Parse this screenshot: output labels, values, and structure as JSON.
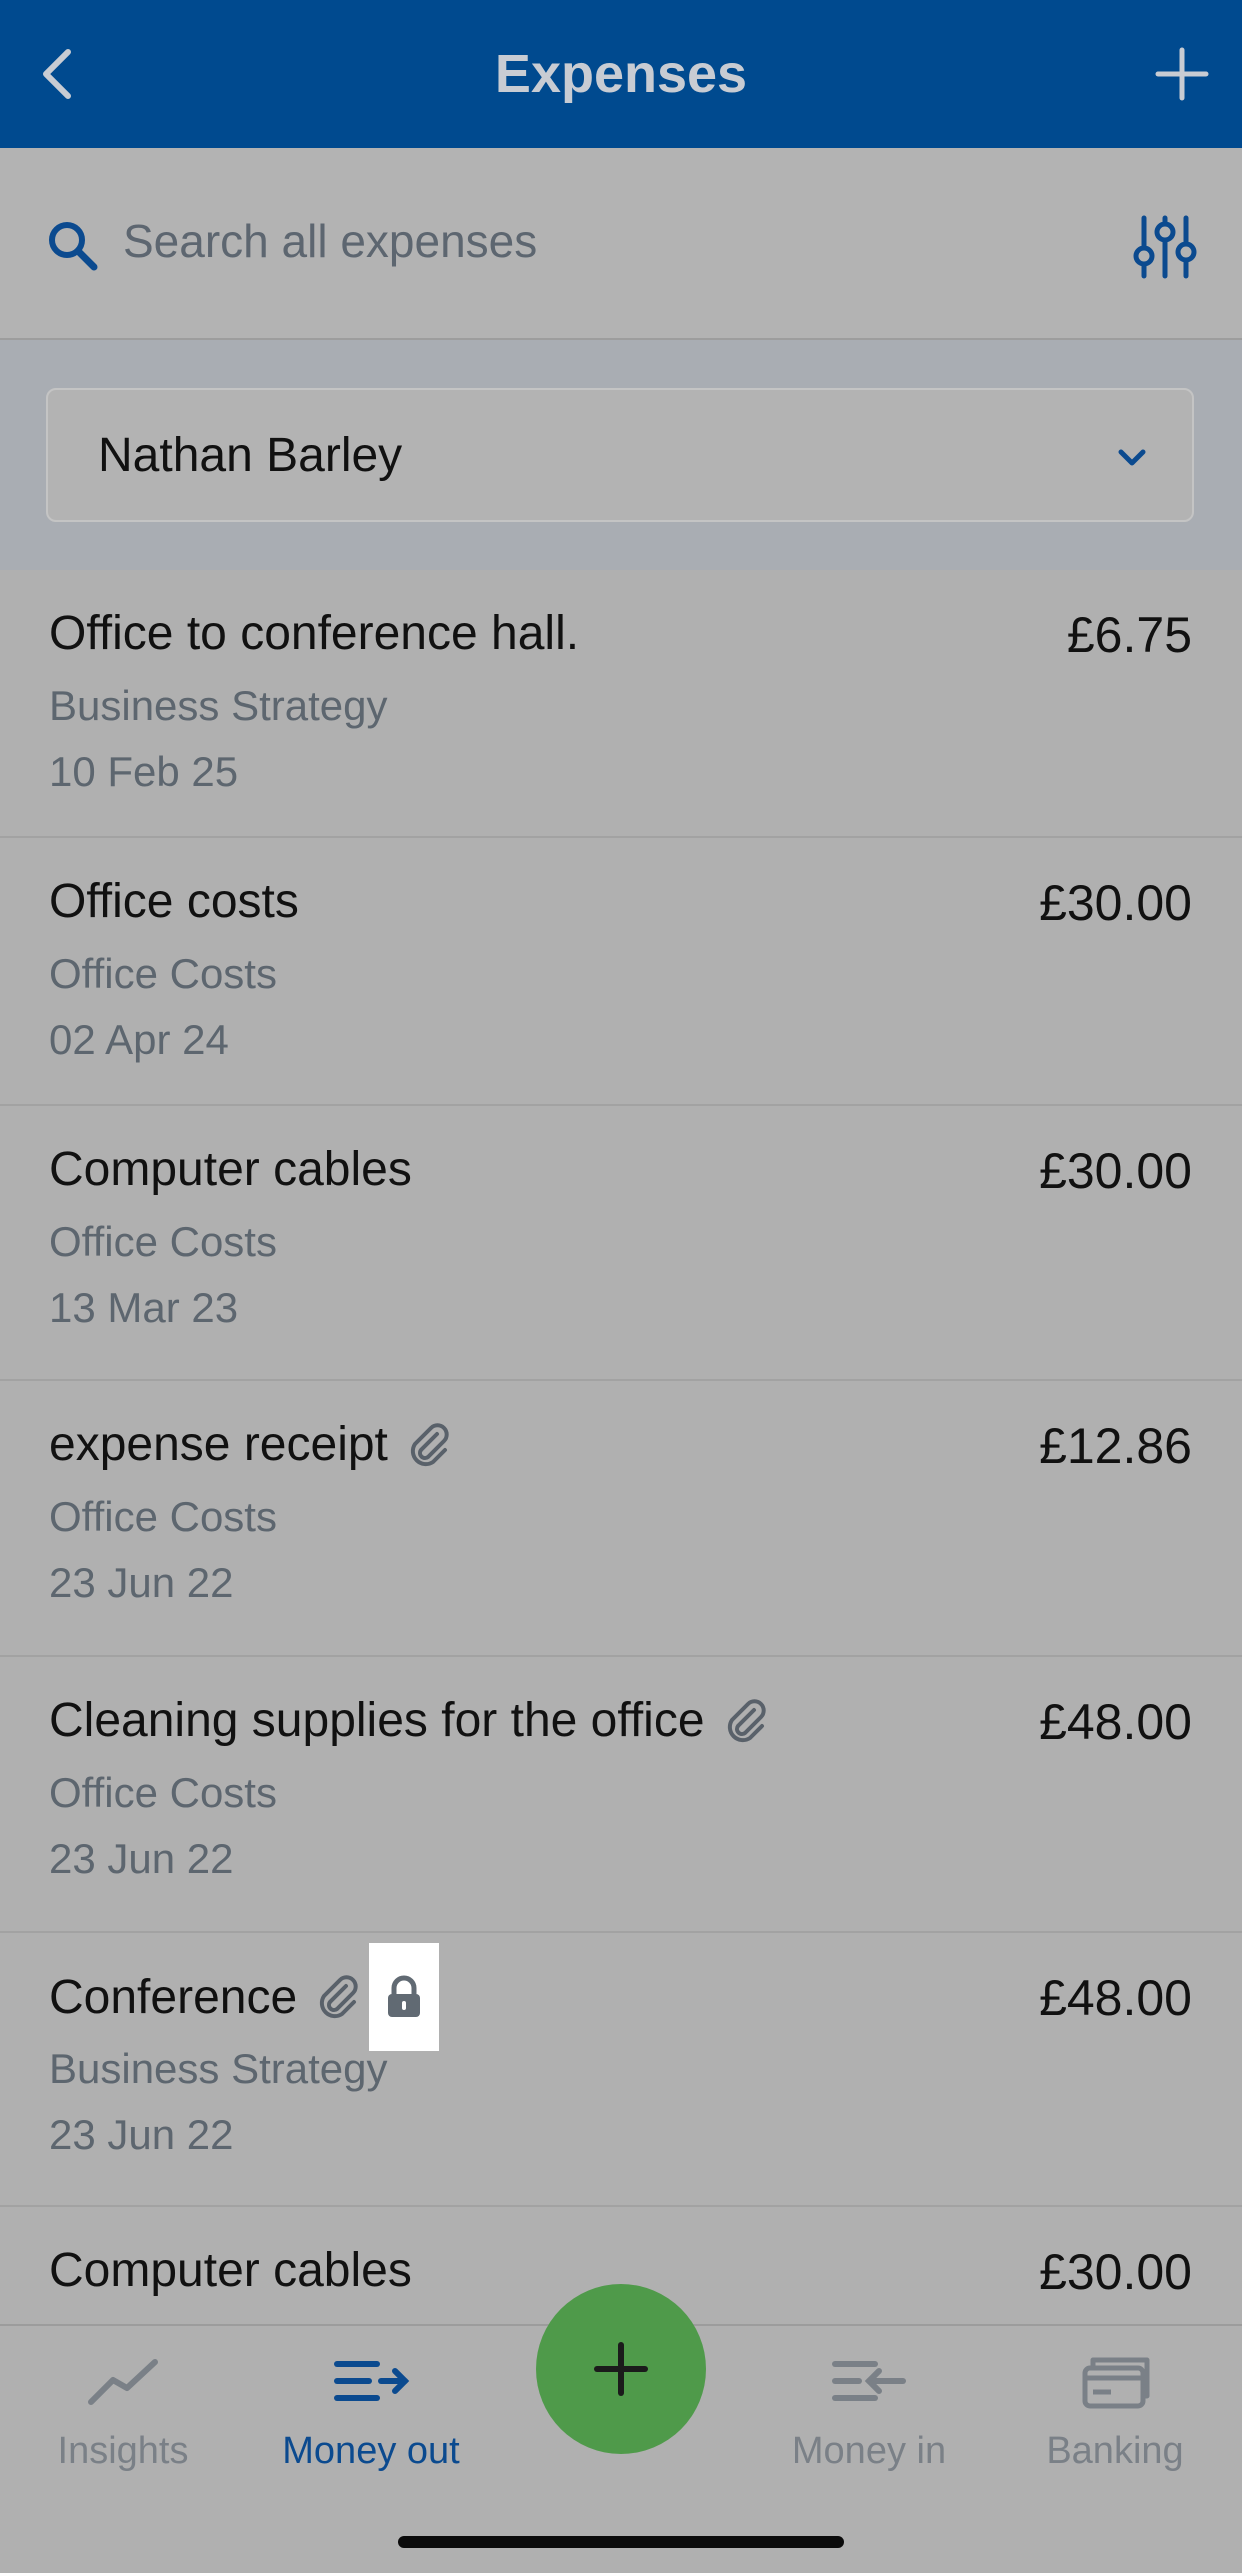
{
  "header": {
    "title": "Expenses"
  },
  "search": {
    "placeholder": "Search all expenses"
  },
  "filter": {
    "selected": "Nathan Barley"
  },
  "expenses": [
    {
      "title": "Office to conference hall.",
      "category": "Business Strategy",
      "date": "10 Feb 25",
      "amount": "£6.75"
    },
    {
      "title": "Office costs",
      "category": "Office Costs",
      "date": "02 Apr 24",
      "amount": "£30.00"
    },
    {
      "title": "Computer cables",
      "category": "Office Costs",
      "date": "13 Mar 23",
      "amount": "£30.00"
    },
    {
      "title": "expense receipt",
      "category": "Office Costs",
      "date": "23 Jun 22",
      "amount": "£12.86"
    },
    {
      "title": "Cleaning supplies for the office",
      "category": "Office Costs",
      "date": "23 Jun 22",
      "amount": "£48.00"
    },
    {
      "title": "Conference",
      "category": "Business Strategy",
      "date": "23 Jun 22",
      "amount": "£48.00"
    },
    {
      "title": "Computer cables",
      "amount": "£30.00"
    }
  ],
  "nav": {
    "insights": "Insights",
    "money_out": "Money out",
    "money_in": "Money in",
    "banking": "Banking"
  },
  "colors": {
    "header": "#004a8f",
    "accent": "#0b4a8f",
    "fab": "#4f9a4a"
  }
}
